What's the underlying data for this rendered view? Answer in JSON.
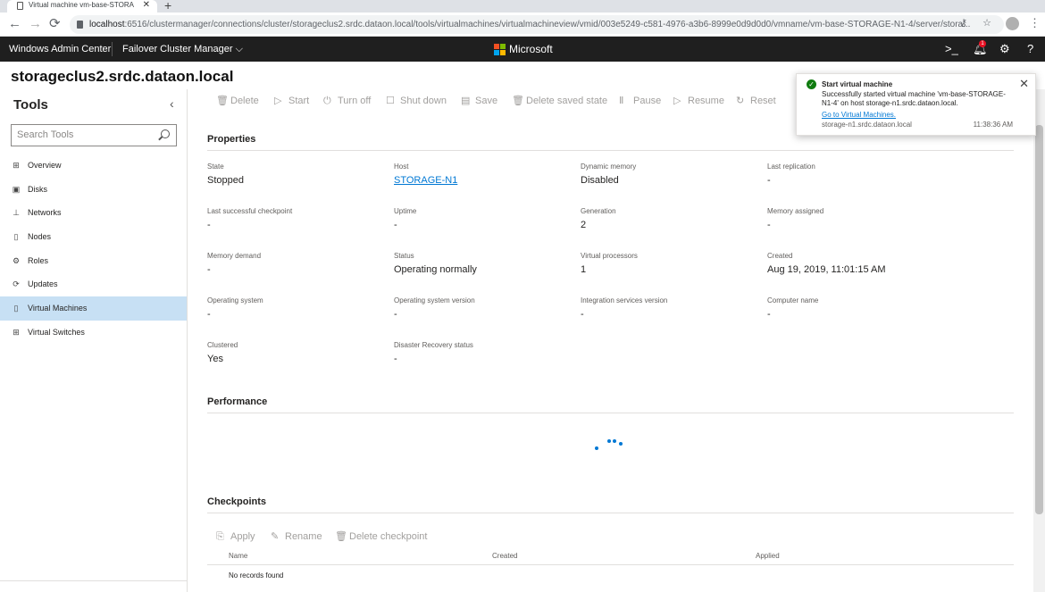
{
  "browser": {
    "tab_title": "Virtual machine vm-base-STORA",
    "tab_close": "✕",
    "new_tab": "+",
    "url_host": "localhost",
    "url_rest": ":6516/clustermanager/connections/cluster/storageclus2.srdc.dataon.local/tools/virtualmachines/virtualmachineview/vmid/003e5249-c581-4976-a3b6-8999e0d9d0d0/vmname/vm-base-STORAGE-N1-4/server/stora..."
  },
  "header": {
    "brand": "Windows Admin Center",
    "context": "Failover Cluster Manager",
    "context_chevron": "⌵",
    "microsoft": "Microsoft",
    "notif_count": "1",
    "ms_colors": [
      "#f25022",
      "#7fba00",
      "#00a4ef",
      "#ffb900"
    ]
  },
  "page": {
    "title": "storageclus2.srdc.dataon.local"
  },
  "sidebar": {
    "title": "Tools",
    "search_placeholder": "Search Tools",
    "items": [
      {
        "label": "Overview",
        "icon": "overview-icon",
        "glyph": "⊞"
      },
      {
        "label": "Disks",
        "icon": "disks-icon",
        "glyph": "▣"
      },
      {
        "label": "Networks",
        "icon": "networks-icon",
        "glyph": "⊥"
      },
      {
        "label": "Nodes",
        "icon": "nodes-icon",
        "glyph": "▯"
      },
      {
        "label": "Roles",
        "icon": "roles-icon",
        "glyph": "⚙"
      },
      {
        "label": "Updates",
        "icon": "updates-icon",
        "glyph": "⟳"
      },
      {
        "label": "Virtual Machines",
        "icon": "virtual-machines-icon",
        "glyph": "▯"
      },
      {
        "label": "Virtual Switches",
        "icon": "virtual-switches-icon",
        "glyph": "⊞"
      }
    ],
    "active_index": 6
  },
  "toolbar": {
    "delete": "Delete",
    "start": "Start",
    "turn_off": "Turn off",
    "shut_down": "Shut down",
    "save": "Save",
    "delete_saved_state": "Delete saved state",
    "pause": "Pause",
    "resume": "Resume",
    "reset": "Reset"
  },
  "properties": {
    "heading": "Properties",
    "items": [
      {
        "label": "State",
        "value": "Stopped"
      },
      {
        "label": "Host",
        "value": "STORAGE-N1"
      },
      {
        "label": "Dynamic memory",
        "value": "Disabled"
      },
      {
        "label": "Last replication",
        "value": "-"
      },
      {
        "label": "Last successful checkpoint",
        "value": "-"
      },
      {
        "label": "Uptime",
        "value": "-"
      },
      {
        "label": "Generation",
        "value": "2"
      },
      {
        "label": "Memory assigned",
        "value": "-"
      },
      {
        "label": "Memory demand",
        "value": "-"
      },
      {
        "label": "Status",
        "value": "Operating normally"
      },
      {
        "label": "Virtual processors",
        "value": "1"
      },
      {
        "label": "Created",
        "value": "Aug 19, 2019, 11:01:15 AM"
      },
      {
        "label": "Operating system",
        "value": "-"
      },
      {
        "label": "Operating system version",
        "value": "-"
      },
      {
        "label": "Integration services version",
        "value": "-"
      },
      {
        "label": "Computer name",
        "value": "-"
      },
      {
        "label": "Clustered",
        "value": "Yes"
      },
      {
        "label": "Disaster Recovery status",
        "value": "-"
      }
    ]
  },
  "performance": {
    "heading": "Performance"
  },
  "checkpoints": {
    "heading": "Checkpoints",
    "apply": "Apply",
    "rename": "Rename",
    "delete": "Delete checkpoint",
    "columns": [
      "Name",
      "Created",
      "Applied"
    ],
    "empty": "No records found"
  },
  "toast": {
    "title": "Start virtual machine",
    "message": "Successfully started virtual machine 'vm-base-STORAGE-N1-4' on host storage-n1.srdc.dataon.local.",
    "link": "Go to Virtual Machines.",
    "host": "storage-n1.srdc.dataon.local",
    "time": "11:38:36 AM"
  }
}
